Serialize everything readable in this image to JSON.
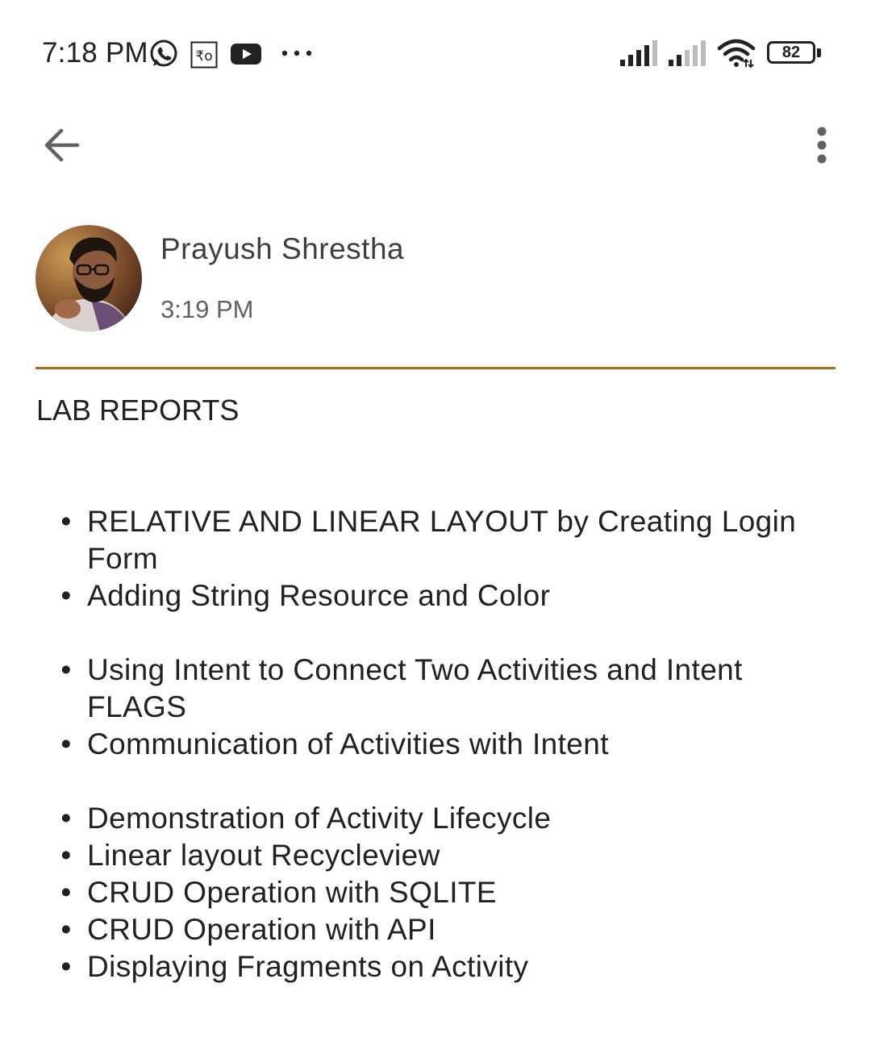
{
  "status_bar": {
    "time": "7:18 PM",
    "battery": "82",
    "icons": [
      "whatsapp-icon",
      "rupee-icon",
      "youtube-icon",
      "more-notifications-icon",
      "signal-sim1-icon",
      "signal-sim2-icon",
      "wifi-icon",
      "battery-icon"
    ]
  },
  "app_bar": {
    "back_icon": "arrow-left-icon",
    "menu_icon": "more-vert-icon"
  },
  "message": {
    "sender": "Prayush Shrestha",
    "time": "3:19 PM",
    "subject": "LAB REPORTS",
    "items": [
      "RELATIVE AND LINEAR LAYOUT by Creating Login Form",
      "Adding String Resource and Color",
      "Using Intent to Connect Two Activities and Intent FLAGS",
      "Communication of Activities with Intent",
      "Demonstration of Activity Lifecycle",
      "Linear layout Recycleview",
      "CRUD Operation with SQLITE",
      "CRUD Operation with API",
      "Displaying Fragments on Activity"
    ]
  },
  "colors": {
    "divider": "#b36b12",
    "text": "#202124",
    "secondary_text": "#5f6368"
  }
}
